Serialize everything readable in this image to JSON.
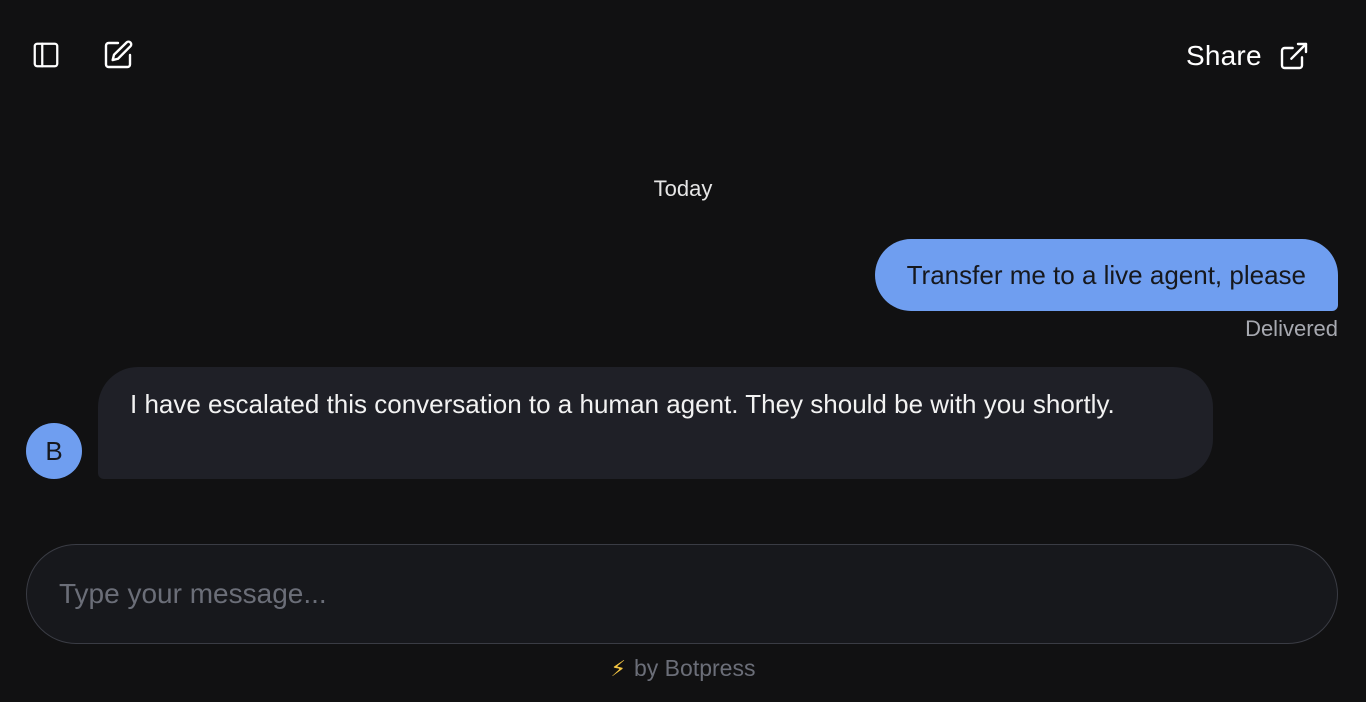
{
  "header": {
    "share_label": "Share",
    "icons": {
      "sidebar": "sidebar-toggle-icon",
      "new_chat": "new-chat-icon",
      "share": "external-link-icon"
    }
  },
  "conversation": {
    "day_label": "Today",
    "messages": [
      {
        "sender": "user",
        "text": "Transfer me to a live agent, please",
        "status": "Delivered"
      },
      {
        "sender": "bot",
        "avatar_initial": "B",
        "text": "I have escalated this conversation to a human agent. They should be with you shortly."
      }
    ]
  },
  "composer": {
    "value": "",
    "placeholder": "Type your message..."
  },
  "footer": {
    "bolt_glyph": "⚡",
    "powered_by": "by Botpress"
  },
  "colors": {
    "background": "#111112",
    "accent": "#6f9ef0",
    "bot_bubble": "#1f2027",
    "bolt": "#f4c542"
  }
}
